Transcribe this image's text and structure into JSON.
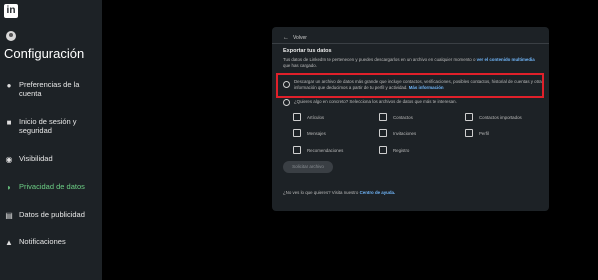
{
  "sidebar": {
    "logo": "in",
    "title": "Configuración",
    "items": [
      {
        "label": "Preferencias de la cuenta",
        "icon": "person-icon"
      },
      {
        "label": "Inicio de sesión y seguridad",
        "icon": "lock-icon"
      },
      {
        "label": "Visibilidad",
        "icon": "eye-icon"
      },
      {
        "label": "Privacidad de datos",
        "icon": "shield-icon"
      },
      {
        "label": "Datos de publicidad",
        "icon": "newspaper-icon"
      },
      {
        "label": "Notificaciones",
        "icon": "bell-icon"
      }
    ],
    "active_color": "#6ccf85"
  },
  "panel": {
    "back_label": "Volver",
    "title": "Exportar tus datos",
    "desc_text": "Tus datos de LinkedIn te pertenecen y puedes descargarlos en un archivo en cualquier momento o",
    "desc_link": "ver el contenido multimedia",
    "desc_tail": "que has cargado.",
    "option1_text": "Descargar un archivo de datos más grande que incluye contactos, verificaciones, posibles contactos, historial de cuentas y otra información que deducimos a partir de tu perfil y actividad.",
    "option1_link": "Más información",
    "option2_text": "¿Quieres algo en concreto? Selecciona los archivos de datos que más te interesan.",
    "checkboxes": [
      "Artículos",
      "Contactos",
      "Contactos importados",
      "Mensajes",
      "Invitaciones",
      "Perfil",
      "Recomendaciones",
      "Registro"
    ],
    "request_button": "Solicitar archivo",
    "footer_text": "¿No ves lo que quieres? Visita nuestro",
    "footer_link": "Centro de ayuda."
  },
  "colors": {
    "highlight": "#e0202a",
    "link": "#71b7fb"
  }
}
